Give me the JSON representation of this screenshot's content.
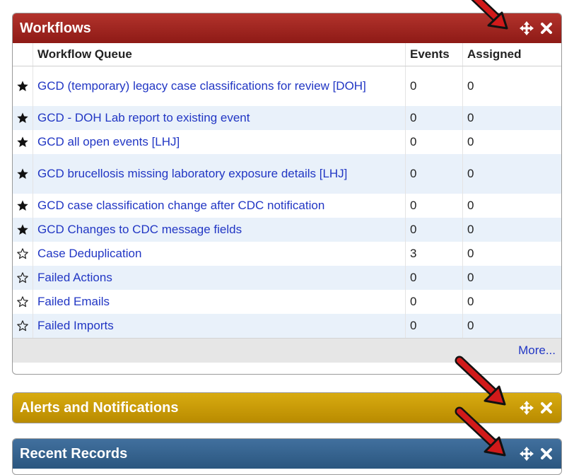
{
  "workflows": {
    "title": "Workflows",
    "color": "#a52a23",
    "columns": {
      "star": "",
      "queue": "Workflow Queue",
      "events": "Events",
      "assigned": "Assigned"
    },
    "rows": [
      {
        "starred": true,
        "queue": "GCD (temporary) legacy case classifications for review [DOH]",
        "events": "0",
        "assigned": "0",
        "tall": true
      },
      {
        "starred": true,
        "queue": "GCD - DOH Lab report to existing event",
        "events": "0",
        "assigned": "0",
        "tall": false
      },
      {
        "starred": true,
        "queue": "GCD all open events [LHJ]",
        "events": "0",
        "assigned": "0",
        "tall": false
      },
      {
        "starred": true,
        "queue": "GCD brucellosis missing laboratory exposure details [LHJ]",
        "events": "0",
        "assigned": "0",
        "tall": true
      },
      {
        "starred": true,
        "queue": "GCD case classification change after CDC notification",
        "events": "0",
        "assigned": "0",
        "tall": false
      },
      {
        "starred": true,
        "queue": "GCD Changes to CDC message fields",
        "events": "0",
        "assigned": "0",
        "tall": false
      },
      {
        "starred": false,
        "queue": "Case Deduplication",
        "events": "3",
        "assigned": "0",
        "tall": false
      },
      {
        "starred": false,
        "queue": "Failed Actions",
        "events": "0",
        "assigned": "0",
        "tall": false
      },
      {
        "starred": false,
        "queue": "Failed Emails",
        "events": "0",
        "assigned": "0",
        "tall": false
      },
      {
        "starred": false,
        "queue": "Failed Imports",
        "events": "0",
        "assigned": "0",
        "tall": false
      }
    ],
    "more_label": "More..."
  },
  "alerts": {
    "title": "Alerts and Notifications",
    "color": "#c99c08"
  },
  "recent": {
    "title": "Recent Records",
    "color": "#36638f"
  },
  "icons": {
    "move": "move-icon",
    "close": "close-icon",
    "star_filled": "star-filled-icon",
    "star_empty": "star-outline-icon"
  },
  "arrow_color": "#d11a1a"
}
